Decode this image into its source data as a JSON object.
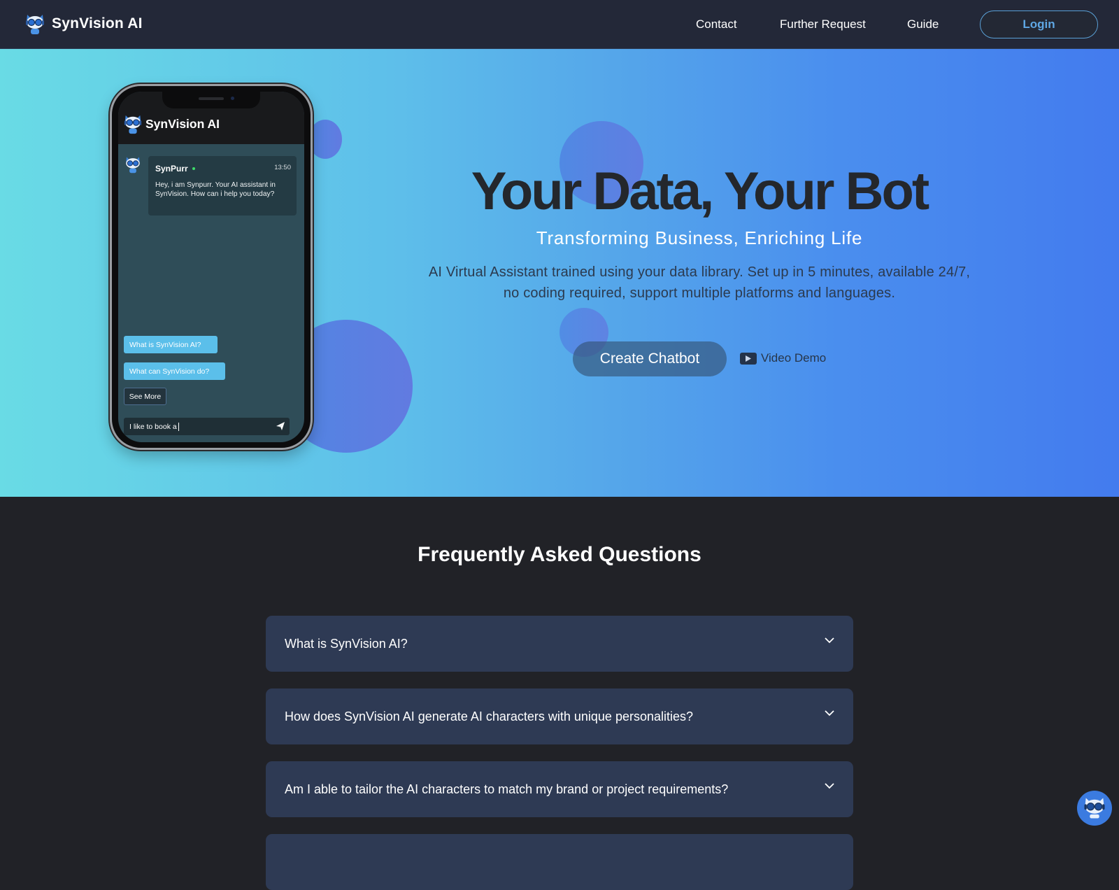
{
  "nav": {
    "brand": "SynVision AI",
    "links": [
      "Contact",
      "Further Request",
      "Guide"
    ],
    "login_label": "Login"
  },
  "hero": {
    "title": "Your Data, Your Bot",
    "subtitle": "Transforming Business, Enriching Life",
    "description": "AI Virtual Assistant trained using your data library. Set up in 5 minutes, available 24/7, no coding required, support multiple platforms and languages.",
    "cta_label": "Create Chatbot",
    "video_label": "Video Demo"
  },
  "phone": {
    "brand": "SynVision AI",
    "message": {
      "sender": "SynPurr",
      "time": "13:50",
      "text": "Hey, i am Synpurr. Your AI assistant in SynVision. How can i help you today?"
    },
    "chips": [
      "What is SynVision AI?",
      "What can SynVision do?"
    ],
    "see_more_label": "See More",
    "input_value": "I like to book a"
  },
  "faq": {
    "title": "Frequently Asked Questions",
    "items": [
      "What is SynVision AI?",
      "How does SynVision AI generate AI characters with unique personalities?",
      "Am I able to tailor the AI characters to match my brand or project requirements?",
      ""
    ]
  },
  "colors": {
    "navbar_bg": "#232838",
    "accent": "#5fa7e4",
    "hero_gradient_start": "#69dbe5",
    "hero_gradient_end": "#437bee",
    "faq_item_bg": "#2e3a54",
    "page_bg": "#212227"
  }
}
